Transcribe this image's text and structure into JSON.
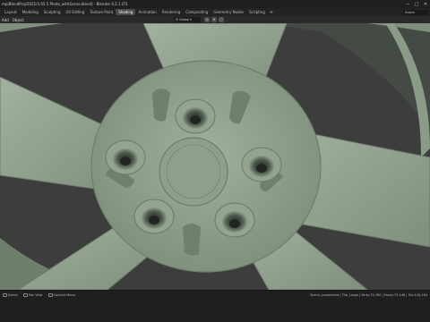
{
  "window": {
    "title": "mp/BlendProj/2021/3.05.5 Photo_withScene.blend] - Blender 4.2.1 LTS",
    "controls": [
      "—",
      "□",
      "✕"
    ]
  },
  "workspace_tabs": [
    {
      "label": "Layout",
      "active": false
    },
    {
      "label": "Modeling",
      "active": false
    },
    {
      "label": "Sculpting",
      "active": false
    },
    {
      "label": "UV Editing",
      "active": false
    },
    {
      "label": "Texture Paint",
      "active": false
    },
    {
      "label": "Shading",
      "active": true
    },
    {
      "label": "Animation",
      "active": false
    },
    {
      "label": "Rendering",
      "active": false
    },
    {
      "label": "Compositing",
      "active": false
    },
    {
      "label": "Geometry Nodes",
      "active": false
    },
    {
      "label": "Scripting",
      "active": false
    }
  ],
  "scene_selector": "Scene",
  "viewport_header": {
    "menus": [
      "Add",
      "Object"
    ],
    "transform_orientation": "Global"
  },
  "statusbar": {
    "left_items": [
      "Select",
      "Pan View",
      "Context Menu"
    ],
    "right_text": "Scene_Lamamaria | Tire_Large | Verts:75,760 | Faces:73,448 | Tris:145,164"
  },
  "colors": {
    "model_green": "#8e9f8b",
    "active_tab": "#4a4a4a",
    "ui_dark": "#1f1f1f"
  }
}
